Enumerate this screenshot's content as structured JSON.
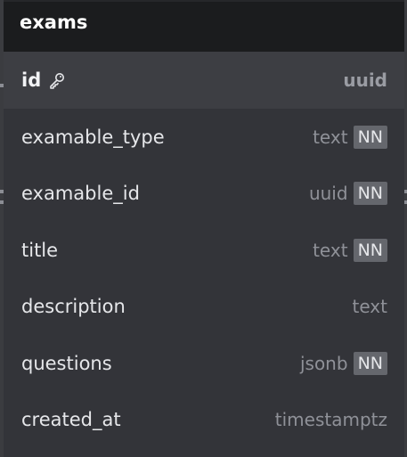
{
  "table": {
    "name": "exams",
    "columns": [
      {
        "name": "id",
        "type": "uuid",
        "primary_key": true,
        "not_null": false
      },
      {
        "name": "examable_type",
        "type": "text",
        "primary_key": false,
        "not_null": true
      },
      {
        "name": "examable_id",
        "type": "uuid",
        "primary_key": false,
        "not_null": true
      },
      {
        "name": "title",
        "type": "text",
        "primary_key": false,
        "not_null": true
      },
      {
        "name": "description",
        "type": "text",
        "primary_key": false,
        "not_null": false
      },
      {
        "name": "questions",
        "type": "jsonb",
        "primary_key": false,
        "not_null": true
      },
      {
        "name": "created_at",
        "type": "timestamptz",
        "primary_key": false,
        "not_null": false
      }
    ],
    "nn_label": "NN"
  },
  "icons": {
    "primary_key": "key-icon"
  },
  "colors": {
    "header_bg": "#1b1c1e",
    "body_bg": "#333439",
    "pk_row_bg": "#3d3e43",
    "badge_bg": "#65676d",
    "type_text": "#8f9198"
  }
}
